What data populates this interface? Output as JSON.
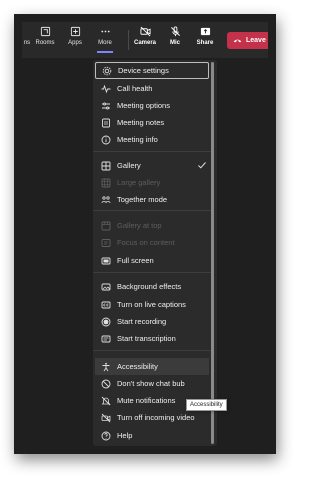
{
  "toolbar": {
    "partial_label": "ns",
    "rooms_label": "Rooms",
    "apps_label": "Apps",
    "more_label": "More",
    "camera_label": "Camera",
    "mic_label": "Mic",
    "share_label": "Share",
    "leave_label": "Leave"
  },
  "menu": {
    "items": [
      {
        "label": "Device settings",
        "icon": "gear-icon",
        "state": "focused"
      },
      {
        "label": "Call health",
        "icon": "pulse-icon"
      },
      {
        "label": "Meeting options",
        "icon": "sliders-icon"
      },
      {
        "label": "Meeting notes",
        "icon": "notes-icon"
      },
      {
        "label": "Meeting info",
        "icon": "info-icon"
      },
      {
        "label": "Gallery",
        "icon": "grid-icon",
        "checked": true
      },
      {
        "label": "Large gallery",
        "icon": "large-grid-icon",
        "disabled": true
      },
      {
        "label": "Together mode",
        "icon": "people-icon"
      },
      {
        "label": "Gallery at top",
        "icon": "gallery-top-icon",
        "disabled": true
      },
      {
        "label": "Focus on content",
        "icon": "focus-icon",
        "disabled": true
      },
      {
        "label": "Full screen",
        "icon": "fullscreen-icon"
      },
      {
        "label": "Background effects",
        "icon": "background-icon"
      },
      {
        "label": "Turn on live captions",
        "icon": "cc-icon"
      },
      {
        "label": "Start recording",
        "icon": "record-icon"
      },
      {
        "label": "Start transcription",
        "icon": "transcription-icon"
      },
      {
        "label": "Accessibility",
        "icon": "accessibility-icon",
        "state": "hovered"
      },
      {
        "label": "Don't show chat bub",
        "icon": "chat-off-icon"
      },
      {
        "label": "Mute notifications",
        "icon": "bell-off-icon"
      },
      {
        "label": "Turn off incoming video",
        "icon": "video-off-icon"
      },
      {
        "label": "Help",
        "icon": "help-icon"
      }
    ]
  },
  "tooltip": {
    "text": "Accessibility"
  },
  "colors": {
    "leave": "#c4314b",
    "accent": "#7f85f5",
    "menu_bg": "#2b2b2b"
  }
}
